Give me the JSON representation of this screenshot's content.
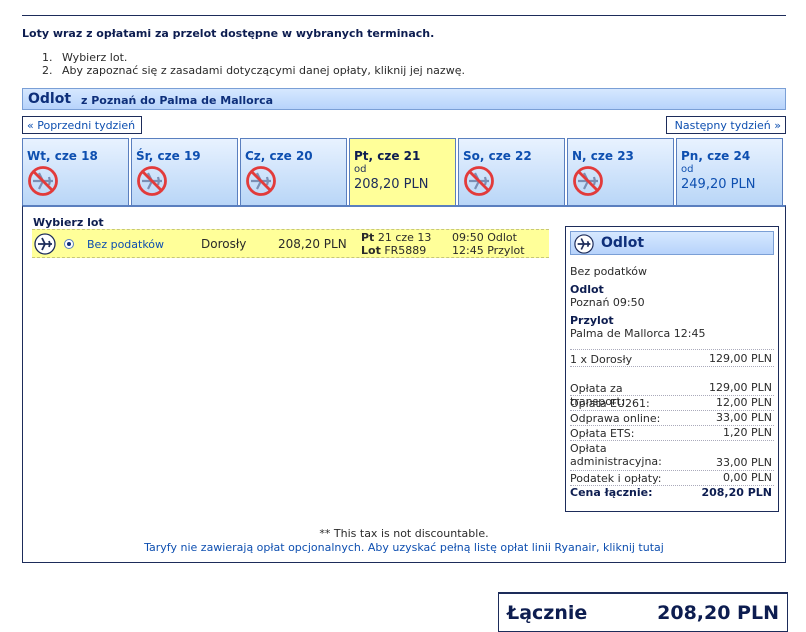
{
  "heading": "Loty wraz z opłatami za przelot dostępne w wybranych terminach.",
  "steps": [
    {
      "n": "1.",
      "text": "Wybierz lot."
    },
    {
      "n": "2.",
      "text": "Aby zapoznać się z zasadami dotyczącymi danej opłaty, kliknij jej nazwę."
    }
  ],
  "section": {
    "title": "Odlot",
    "route": "z Poznań do Palma de Mallorca"
  },
  "nav": {
    "prev": "« Poprzedni tydzień",
    "next": "Następny tydzień »"
  },
  "days": [
    {
      "label": "Wt, cze 18",
      "available": false
    },
    {
      "label": "Śr, cze 19",
      "available": false
    },
    {
      "label": "Cz, cze 20",
      "available": false
    },
    {
      "label": "Pt, cze 21",
      "available": true,
      "selected": true,
      "od": "od",
      "price": "208,20 PLN"
    },
    {
      "label": "So, cze 22",
      "available": false
    },
    {
      "label": "N, cze 23",
      "available": false
    },
    {
      "label": "Pn, cze 24",
      "available": true,
      "selected": false,
      "od": "od",
      "price": "249,20 PLN"
    }
  ],
  "choose_label": "Wybierz lot",
  "flight": {
    "fare": "Bez podatków",
    "passenger": "Dorosły",
    "price": "208,20 PLN",
    "day": "Pt",
    "date": "21 cze 13",
    "lot_label": "Lot",
    "number": "FR5889",
    "dep_time": "09:50 Odlot",
    "arr_time": "12:45 Przylot"
  },
  "summary": {
    "title": "Odlot",
    "fare": "Bez podatków",
    "dep_label": "Odlot",
    "dep_value": "Poznań 09:50",
    "arr_label": "Przylot",
    "arr_value": "Palma de Mallorca 12:45",
    "pax_line": {
      "label": "1 x Dorosły",
      "value": "129,00 PLN"
    },
    "fees": [
      {
        "label": "Opłata za transport:",
        "value": "129,00 PLN"
      },
      {
        "label": "Opłata EU261:",
        "value": "12,00 PLN"
      },
      {
        "label": "Odprawa online:",
        "value": "33,00 PLN"
      },
      {
        "label": "Opłata ETS:",
        "value": "1,20 PLN"
      },
      {
        "label": "Opłata administracyjna:",
        "value": "33,00 PLN"
      },
      {
        "label": "Podatek i opłaty:",
        "value": "0,00 PLN"
      }
    ],
    "total": {
      "label": "Cena łącznie:",
      "value": "208,20 PLN"
    }
  },
  "tax_note": "** This tax is not discountable.",
  "fares_note": "Taryfy nie zawierają opłat opcjonalnych. Aby uzyskać pełną listę opłat linii Ryanair, kliknij tutaj",
  "grand_total": {
    "label": "Łącznie",
    "value": "208,20 PLN"
  },
  "colors": {
    "accent": "#0e4fb0",
    "selected": "#ffff99",
    "no_flight": "#e23b3b"
  }
}
